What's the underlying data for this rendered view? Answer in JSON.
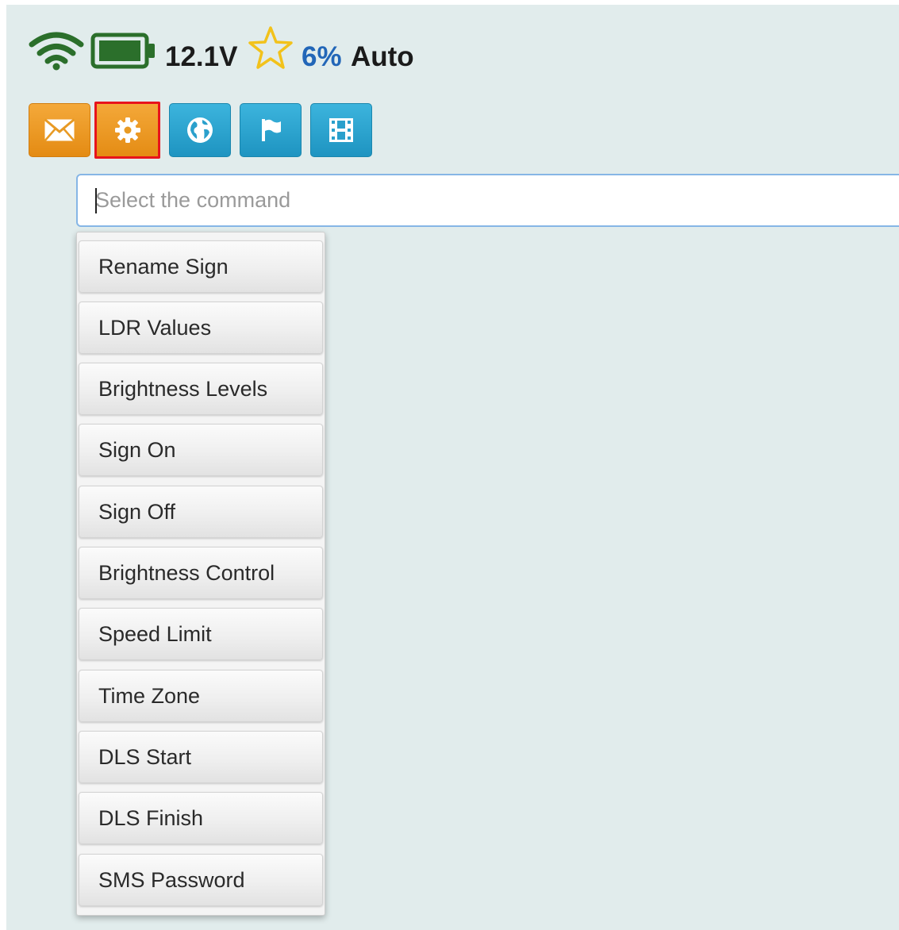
{
  "status": {
    "voltage": "12.1V",
    "brightness_percent": "6%",
    "brightness_mode": "Auto",
    "wifi_icon": "wifi-icon",
    "battery_icon": "battery-icon",
    "star_icon": "star-outline-icon",
    "colors": {
      "wifi": "#2b6f2b",
      "battery": "#2b6f2b",
      "star": "#f2c21b",
      "percent": "#2266b8"
    }
  },
  "toolbar": {
    "buttons": [
      {
        "icon": "envelope-icon",
        "color": "#f0a02a"
      },
      {
        "icon": "gear-icon",
        "color": "#f0a02a",
        "selected": true
      },
      {
        "icon": "globe-icon",
        "color": "#2aa6d4"
      },
      {
        "icon": "flag-icon",
        "color": "#2aa6d4"
      },
      {
        "icon": "film-icon",
        "color": "#2aa6d4"
      }
    ]
  },
  "command": {
    "placeholder": "Select the command",
    "value": ""
  },
  "menu": {
    "items": [
      "Rename Sign",
      "LDR Values",
      "Brightness Levels",
      "Sign On",
      "Sign Off",
      "Brightness Control",
      "Speed Limit",
      "Time Zone",
      "DLS Start",
      "DLS Finish",
      "SMS Password"
    ]
  }
}
